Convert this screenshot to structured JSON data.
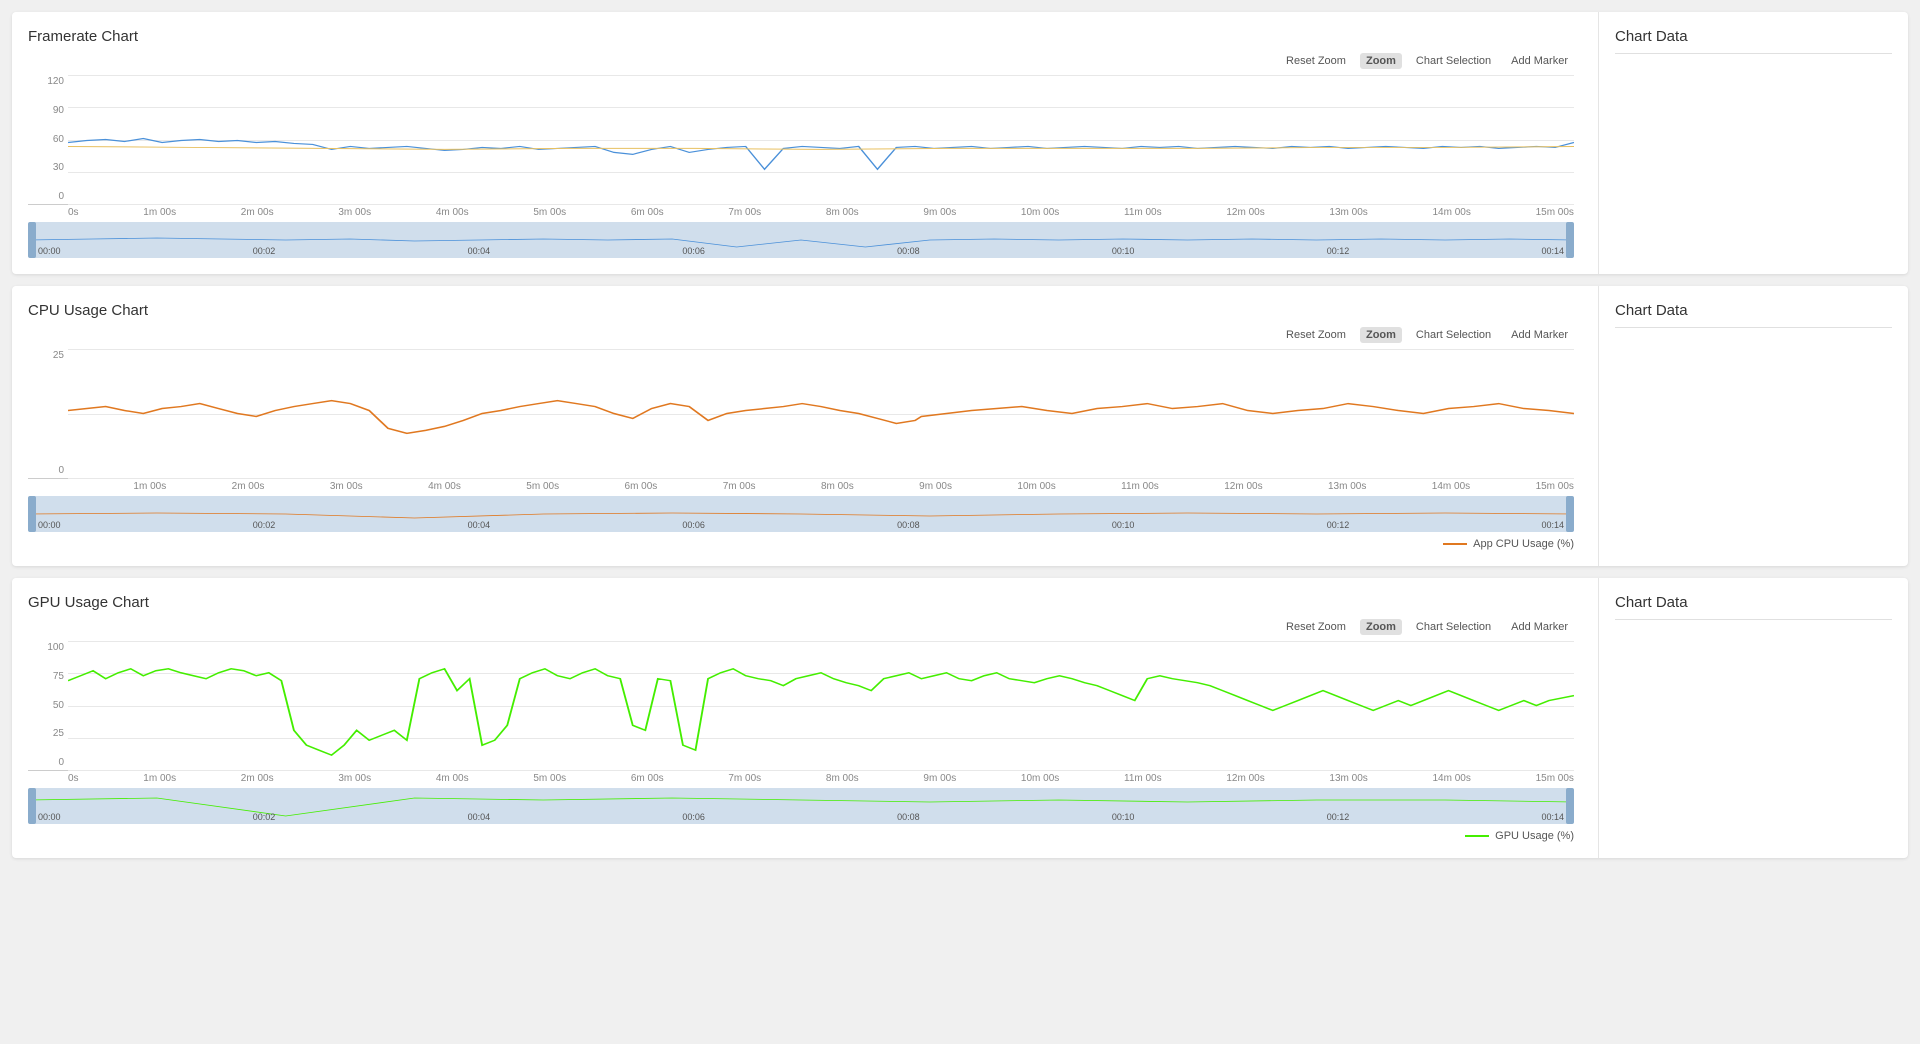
{
  "charts": [
    {
      "id": "framerate",
      "title": "Framerate Chart",
      "sidebar_title": "Chart Data",
      "y_labels": [
        "120",
        "90",
        "60",
        "30",
        "0"
      ],
      "y_max": 120,
      "x_labels": [
        "0s",
        "1m 00s",
        "2m 00s",
        "3m 00s",
        "4m 00s",
        "5m 00s",
        "6m 00s",
        "7m 00s",
        "8m 00s",
        "9m 00s",
        "10m 00s",
        "11m 00s",
        "12m 00s",
        "13m 00s",
        "14m 00s",
        "15m 00s"
      ],
      "minimap_labels": [
        "00:00",
        "00:02",
        "00:04",
        "00:06",
        "00:08",
        "00:10",
        "00:12",
        "00:14"
      ],
      "line_color": "#4a90d9",
      "line_color2": "#e8c060",
      "legend": null,
      "controls": [
        "Reset Zoom",
        "Zoom",
        "Chart Selection",
        "Add Marker"
      ],
      "active_control": "Zoom"
    },
    {
      "id": "cpu",
      "title": "CPU Usage Chart",
      "sidebar_title": "Chart Data",
      "y_labels": [
        "25",
        "",
        "0"
      ],
      "y_max": 40,
      "x_labels": [
        "",
        "1m 00s",
        "2m 00s",
        "3m 00s",
        "4m 00s",
        "5m 00s",
        "6m 00s",
        "7m 00s",
        "8m 00s",
        "9m 00s",
        "10m 00s",
        "11m 00s",
        "12m 00s",
        "13m 00s",
        "14m 00s",
        "15m 00s"
      ],
      "minimap_labels": [
        "00:00",
        "00:02",
        "00:04",
        "00:06",
        "00:08",
        "00:10",
        "00:12",
        "00:14"
      ],
      "line_color": "#e07820",
      "legend": "App CPU Usage (%)",
      "controls": [
        "Reset Zoom",
        "Zoom",
        "Chart Selection",
        "Add Marker"
      ],
      "active_control": "Zoom"
    },
    {
      "id": "gpu",
      "title": "GPU Usage Chart",
      "sidebar_title": "Chart Data",
      "y_labels": [
        "100",
        "75",
        "50",
        "25",
        "0"
      ],
      "y_max": 110,
      "x_labels": [
        "0s",
        "1m 00s",
        "2m 00s",
        "3m 00s",
        "4m 00s",
        "5m 00s",
        "6m 00s",
        "7m 00s",
        "8m 00s",
        "9m 00s",
        "10m 00s",
        "11m 00s",
        "12m 00s",
        "13m 00s",
        "14m 00s",
        "15m 00s"
      ],
      "minimap_labels": [
        "00:00",
        "00:02",
        "00:04",
        "00:06",
        "00:08",
        "00:10",
        "00:12",
        "00:14"
      ],
      "line_color": "#44ee00",
      "legend": "GPU Usage (%)",
      "controls": [
        "Reset Zoom",
        "Zoom",
        "Chart Selection",
        "Add Marker"
      ],
      "active_control": "Zoom"
    }
  ]
}
